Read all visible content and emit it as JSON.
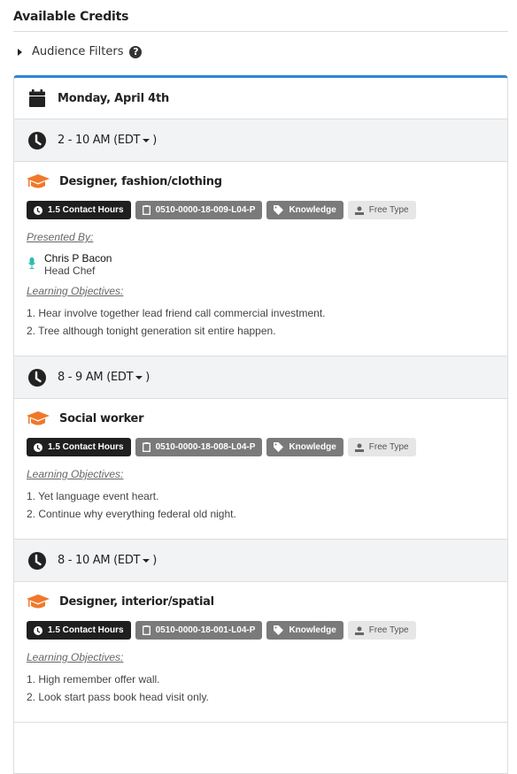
{
  "page": {
    "title": "Available Credits",
    "audience_filters_label": "Audience Filters"
  },
  "colors": {
    "accent_border": "#2f86d3",
    "cap_icon": "#f0782a",
    "mic_icon": "#2bbbad",
    "badge_dark": "#1f1f1f",
    "badge_gray": "#7a7a7a",
    "badge_light": "#e6e6e6"
  },
  "schedule": {
    "date": "Monday, April 4th",
    "slots": [
      {
        "time": "2 - 10 AM",
        "timezone": "(EDT",
        "close_paren": ")",
        "session": {
          "title": "Designer, fashion/clothing",
          "badges": {
            "hours": "1.5 Contact Hours",
            "code": "0510-0000-18-009-L04-P",
            "type": "Knowledge",
            "audience": "Free Type"
          },
          "presented_by_label": "Presented By:",
          "presenter": {
            "name": "Chris P Bacon",
            "role": "Head Chef"
          },
          "objectives_label": "Learning Objectives:",
          "objectives": [
            "1. Hear involve together lead friend call commercial investment.",
            "2. Tree although tonight generation sit entire happen."
          ]
        }
      },
      {
        "time": "8 - 9 AM",
        "timezone": "(EDT",
        "close_paren": ")",
        "session": {
          "title": "Social worker",
          "badges": {
            "hours": "1.5 Contact Hours",
            "code": "0510-0000-18-008-L04-P",
            "type": "Knowledge",
            "audience": "Free Type"
          },
          "objectives_label": "Learning Objectives:",
          "objectives": [
            "1. Yet language event heart.",
            "2. Continue why everything federal old night."
          ]
        }
      },
      {
        "time": "8 - 10 AM",
        "timezone": "(EDT",
        "close_paren": ")",
        "session": {
          "title": "Designer, interior/spatial",
          "badges": {
            "hours": "1.5 Contact Hours",
            "code": "0510-0000-18-001-L04-P",
            "type": "Knowledge",
            "audience": "Free Type"
          },
          "objectives_label": "Learning Objectives:",
          "objectives": [
            "1. High remember offer wall.",
            "2. Look start pass book head visit only."
          ]
        }
      }
    ]
  }
}
